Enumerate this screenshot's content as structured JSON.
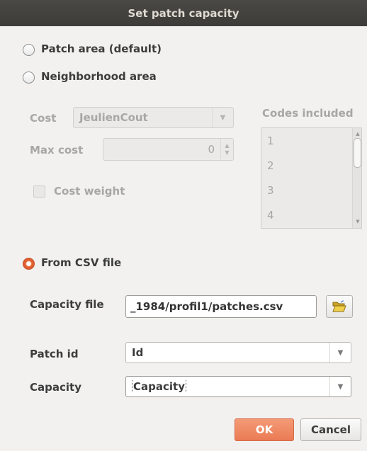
{
  "window": {
    "title": "Set patch capacity"
  },
  "options": {
    "patch_area": {
      "label": "Patch area (default)",
      "selected": false
    },
    "neighborhood_area": {
      "label": "Neighborhood area",
      "selected": false
    },
    "from_csv": {
      "label": "From CSV file",
      "selected": true
    }
  },
  "neighborhood": {
    "cost_label": "Cost",
    "cost_value": "JeulienCout",
    "max_cost_label": "Max cost",
    "max_cost_value": "0",
    "cost_weight_label": "Cost weight",
    "codes_label": "Codes included",
    "codes": [
      "1",
      "2",
      "3",
      "4"
    ]
  },
  "csv": {
    "capacity_file_label": "Capacity file",
    "capacity_file_value": "_1984/profil1/patches.csv",
    "patch_id_label": "Patch id",
    "patch_id_value": "Id",
    "capacity_label": "Capacity",
    "capacity_value": "Capacity"
  },
  "buttons": {
    "ok": "OK",
    "cancel": "Cancel"
  },
  "icons": {
    "browse": "folder-open-icon",
    "combo_arrow": "chevron-down-icon"
  },
  "colors": {
    "accent": "#e8693a",
    "titlebar": "#3c3b37",
    "background": "#f2f1f0"
  }
}
